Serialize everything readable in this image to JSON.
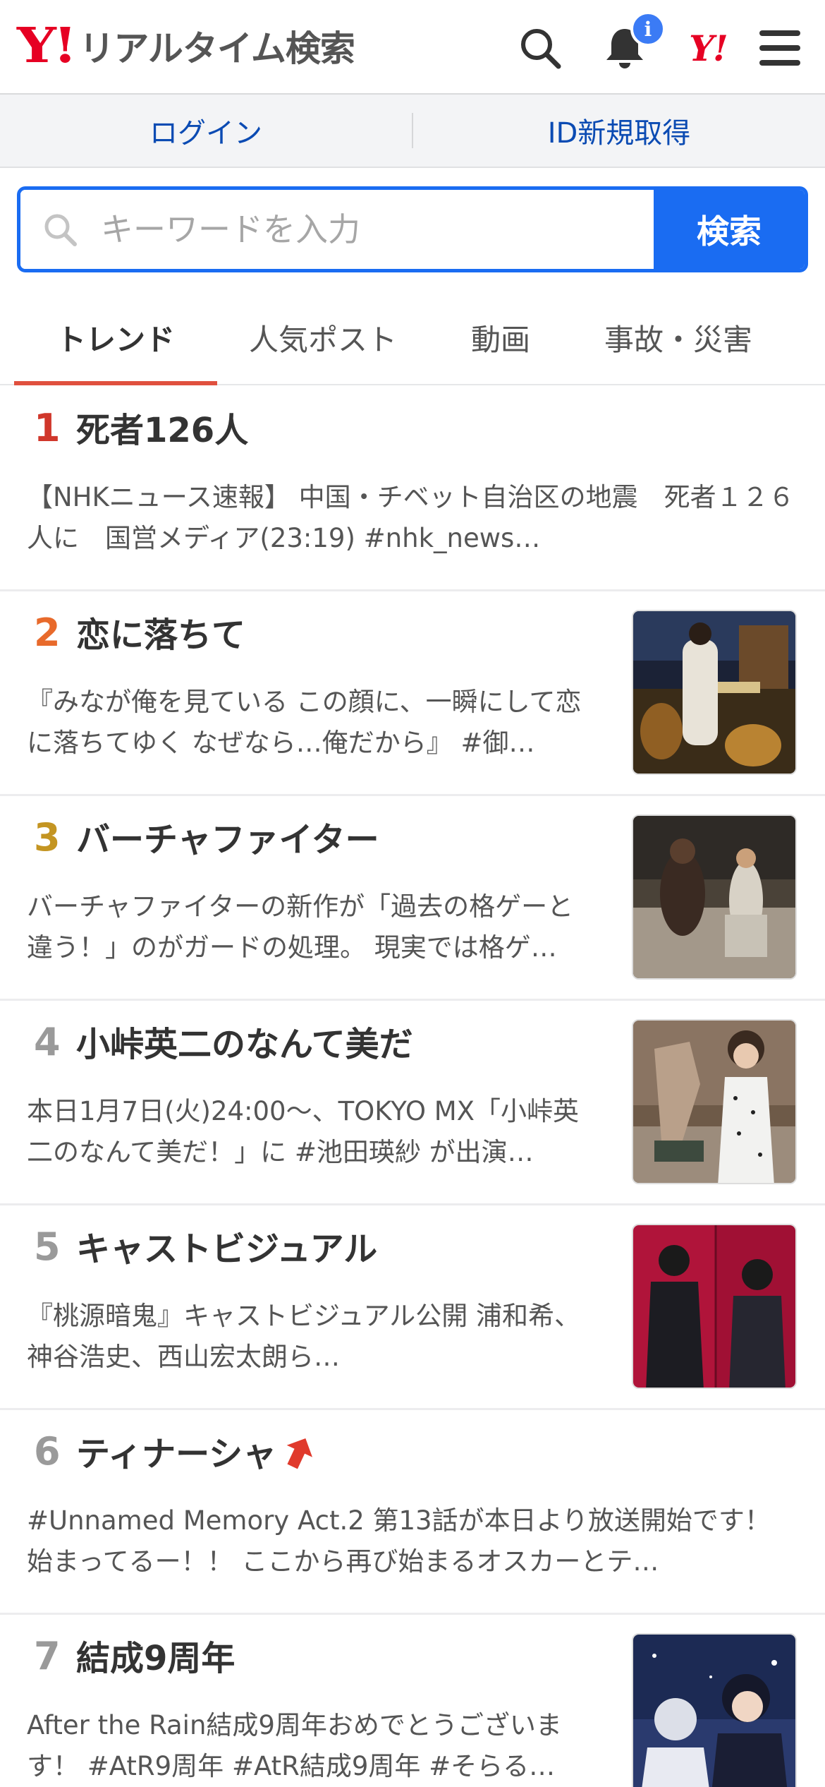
{
  "header": {
    "logo_mark": "Y!",
    "logo_text": "リアルタイム検索",
    "yj_mark": "Y!",
    "notification_badge": "i"
  },
  "login_bar": {
    "login": "ログイン",
    "signup": "ID新規取得"
  },
  "search": {
    "placeholder": "キーワードを入力",
    "button": "検索"
  },
  "tabs": [
    {
      "label": "トレンド",
      "active": true
    },
    {
      "label": "人気ポスト",
      "active": false
    },
    {
      "label": "動画",
      "active": false
    },
    {
      "label": "事故・災害",
      "active": false
    }
  ],
  "trends": [
    {
      "rank": "1",
      "title": "死者126人",
      "desc": "【NHKニュース速報】 中国・チベット自治区の地震　死者１２６人に　国営メディア(23:19) #nhk_news…",
      "has_image": false
    },
    {
      "rank": "2",
      "title": "恋に落ちて",
      "desc": "『みなが俺を見ている この顔に、一瞬にして恋に落ちてゆく なぜなら…俺だから』 #御…",
      "has_image": true
    },
    {
      "rank": "3",
      "title": "バーチャファイター",
      "desc": "バーチャファイターの新作が「過去の格ゲーと違う！」のがガードの処理。 現実では格ゲ…",
      "has_image": true
    },
    {
      "rank": "4",
      "title": "小峠英二のなんて美だ",
      "desc": "本日1月7日(火)24:00〜、TOKYO MX「小峠英二のなんて美だ！」に #池田瑛紗 が出演…",
      "has_image": true
    },
    {
      "rank": "5",
      "title": "キャストビジュアル",
      "desc": "『桃源暗鬼』キャストビジュアル公開 浦和希、神谷浩史、西山宏太朗ら…",
      "has_image": true
    },
    {
      "rank": "6",
      "title": "ティナーシャ",
      "desc": "#Unnamed Memory Act.2 第13話が本日より放送開始です！ 始まってるー！！ ここから再び始まるオスカーとテ…",
      "has_image": false,
      "rising": true
    },
    {
      "rank": "7",
      "title": "結成9周年",
      "desc": "After the Rain結成9周年おめでとうございます！ #AtR9周年 #AtR結成9周年 #そらる…",
      "has_image": true
    }
  ],
  "colors": {
    "accent_blue": "#1a6cf2",
    "brand_red": "#e60023",
    "rank1": "#d0372b",
    "rank2": "#e86a2b",
    "rank3": "#c49522",
    "rank_other": "#9a9a9a"
  }
}
